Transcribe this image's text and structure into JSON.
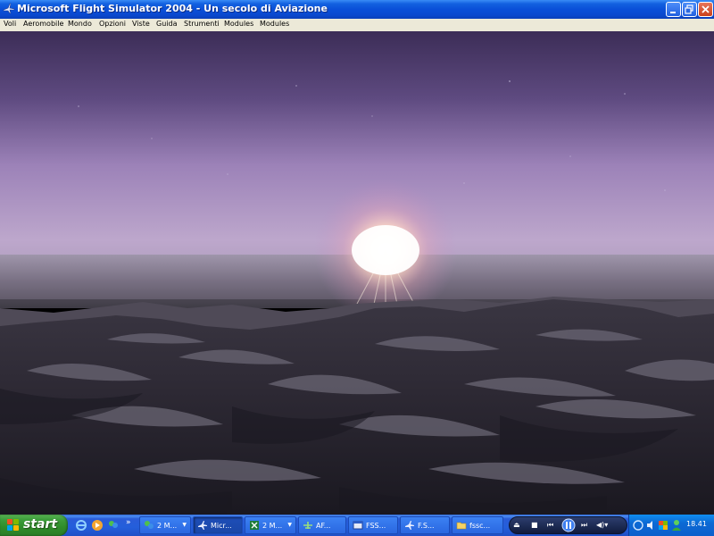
{
  "window": {
    "title": "Microsoft Flight Simulator 2004 - Un secolo di Aviazione",
    "app_icon": "airplane-icon",
    "controls": [
      "minimize-icon",
      "restore-icon",
      "close-icon"
    ]
  },
  "menu": {
    "items": [
      {
        "label": "Voli"
      },
      {
        "label": "Aeromobile"
      },
      {
        "label": "Mondo"
      },
      {
        "label": "Opzioni"
      },
      {
        "label": "Viste"
      },
      {
        "label": "Guida"
      },
      {
        "label": "Strumenti"
      },
      {
        "label": "Modules"
      },
      {
        "label": "Modules"
      }
    ]
  },
  "scene": {
    "colors": {
      "sky_top": "#3f2f5c",
      "sky_mid": "#8e72ad",
      "horizon": "#c3b0cf",
      "haze": "#6a6270",
      "terrain_dark": "#1e1b24",
      "terrain_light": "#4a4552",
      "sun": "#fffce8"
    }
  },
  "taskbar": {
    "start_label": "start",
    "quick_launch": [
      "internet-explorer-icon",
      "media-player-icon",
      "messenger-icon"
    ],
    "overflow": "»",
    "tasks": [
      {
        "label": "2 M...",
        "icon": "messenger-icon",
        "has_arrow": true
      },
      {
        "label": "Micr...",
        "icon": "airplane-icon",
        "active": true
      },
      {
        "label": "2 M...",
        "icon": "spreadsheet-icon",
        "has_arrow": true
      },
      {
        "label": "AF...",
        "icon": "aircraft-tool-icon"
      },
      {
        "label": "FSS...",
        "icon": "window-app-icon"
      },
      {
        "label": "F.S...",
        "icon": "airplane-icon"
      },
      {
        "label": "fssc...",
        "icon": "folder-icon"
      }
    ],
    "media_controls": [
      "eject-icon",
      "stop-icon",
      "previous-icon",
      "pause-icon",
      "next-icon",
      "volume-icon"
    ],
    "tray_icons": [
      "network-icon",
      "sound-icon",
      "security-icon",
      "user-icon"
    ],
    "clock": "18.41"
  }
}
